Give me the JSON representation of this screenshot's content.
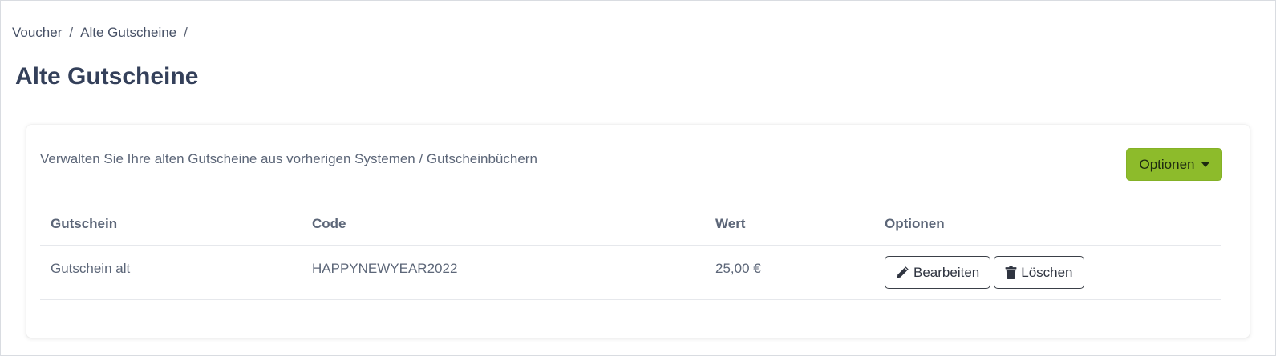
{
  "breadcrumb": {
    "items": [
      "Voucher",
      "Alte Gutscheine"
    ],
    "separator": "/"
  },
  "page": {
    "title": "Alte Gutscheine"
  },
  "card": {
    "description": "Verwalten Sie Ihre alten Gutscheine aus vorherigen Systemen / Gutscheinbüchern",
    "options_button": {
      "label": "Optionen",
      "icon": "caret-down-icon",
      "color": "#8dbb2b"
    }
  },
  "table": {
    "columns": [
      "Gutschein",
      "Code",
      "Wert",
      "Optionen"
    ],
    "rows": [
      {
        "voucher": "Gutschein alt",
        "code": "HAPPYNEWYEAR2022",
        "value": "25,00 €",
        "edit_label": "Bearbeiten",
        "edit_icon": "pencil-icon",
        "delete_label": "Löschen",
        "delete_icon": "trash-icon"
      }
    ]
  }
}
